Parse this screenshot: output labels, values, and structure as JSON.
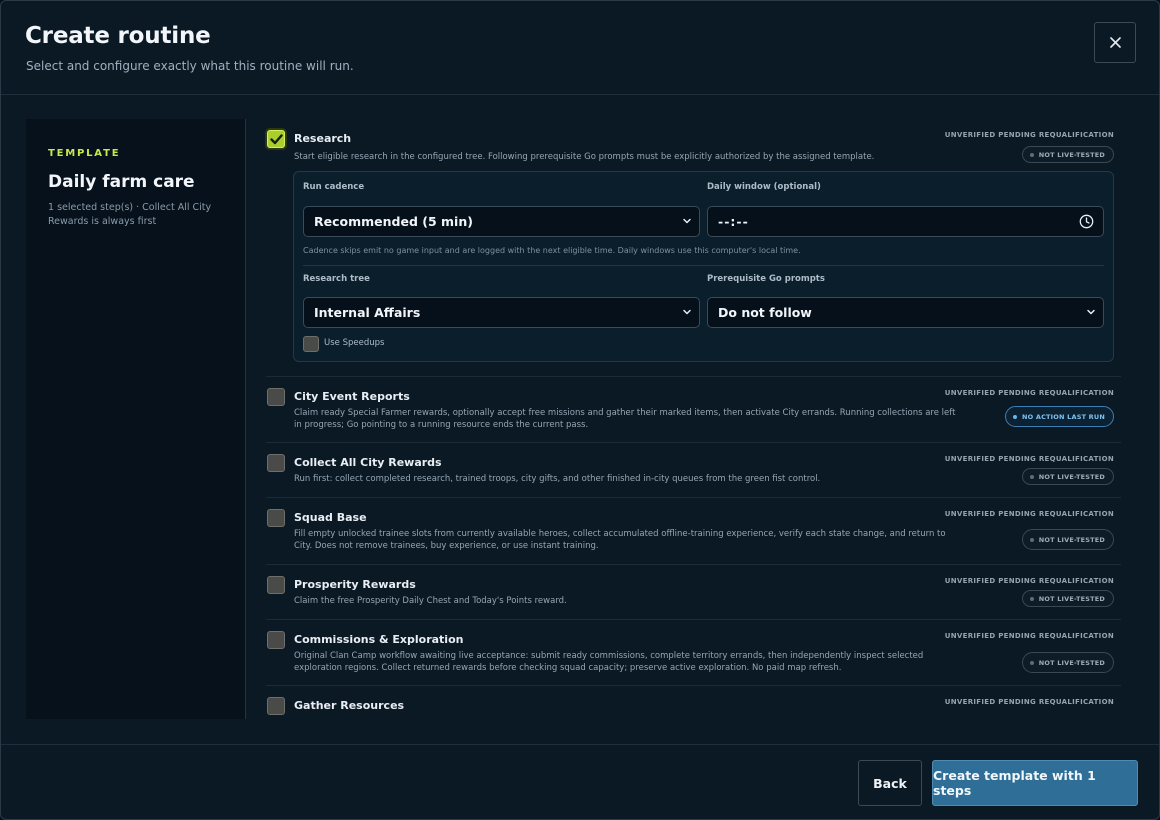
{
  "header": {
    "title": "Create routine",
    "subtitle": "Select and configure exactly what this routine will run.",
    "close_icon": "close-icon"
  },
  "template": {
    "label": "TEMPLATE",
    "name": "Daily farm care",
    "description": "1 selected step(s) · Collect All City Rewards is always first"
  },
  "steps": [
    {
      "title": "Research",
      "checked": true,
      "description": "Start eligible research in the configured tree. Following prerequisite Go prompts must be explicitly authorized by the assigned template.",
      "status": "UNVERIFIED PENDING REQUALIFICATION",
      "badge": "NOT LIVE-TESTED",
      "config": {
        "run_cadence_label": "Run cadence",
        "run_cadence_value": "Recommended (5 min)",
        "daily_window_label": "Daily window (optional)",
        "daily_window_value": "--:--",
        "hint": "Cadence skips emit no game input and are logged with the next eligible time. Daily windows use this computer's local time.",
        "research_tree_label": "Research tree",
        "research_tree_value": "Internal Affairs",
        "prereq_label": "Prerequisite Go prompts",
        "prereq_value": "Do not follow",
        "speedups_label": "Use Speedups",
        "speedups_checked": false
      }
    },
    {
      "title": "City Event Reports",
      "checked": false,
      "description": "Claim ready Special Farmer rewards, optionally accept free missions and gather their marked items, then activate City errands. Running collections are left in progress; Go pointing to a running resource ends the current pass.",
      "status": "UNVERIFIED PENDING REQUALIFICATION",
      "badge": "NO ACTION LAST RUN"
    },
    {
      "title": "Collect All City Rewards",
      "checked": false,
      "description": "Run first: collect completed research, trained troops, city gifts, and other finished in-city queues from the green fist control.",
      "status": "UNVERIFIED PENDING REQUALIFICATION",
      "badge": "NOT LIVE-TESTED"
    },
    {
      "title": "Squad Base",
      "checked": false,
      "description": "Fill empty unlocked trainee slots from currently available heroes, collect accumulated offline-training experience, verify each state change, and return to City. Does not remove trainees, buy experience, or use instant training.",
      "status": "UNVERIFIED PENDING REQUALIFICATION",
      "badge": "NOT LIVE-TESTED"
    },
    {
      "title": "Prosperity Rewards",
      "checked": false,
      "description": "Claim the free Prosperity Daily Chest and Today's Points reward.",
      "status": "UNVERIFIED PENDING REQUALIFICATION",
      "badge": "NOT LIVE-TESTED"
    },
    {
      "title": "Commissions & Exploration",
      "checked": false,
      "description": "Original Clan Camp workflow awaiting live acceptance: submit ready commissions, complete territory errands, then independently inspect selected exploration regions. Collect returned rewards before checking squad capacity; preserve active exploration. No paid map refresh.",
      "status": "UNVERIFIED PENDING REQUALIFICATION",
      "badge": "NOT LIVE-TESTED"
    },
    {
      "title": "Gather Resources",
      "checked": false,
      "status": "UNVERIFIED PENDING REQUALIFICATION"
    }
  ],
  "footer": {
    "back_label": "Back",
    "create_label": "Create template with 1 steps"
  },
  "colors": {
    "accent": "#c8e84a",
    "primary_button": "#2f6f97",
    "badge_action": "#66b6ee"
  },
  "icons": {
    "checkmark": "checkmark-icon",
    "chevron": "chevron-down-icon",
    "clock": "clock-icon"
  }
}
